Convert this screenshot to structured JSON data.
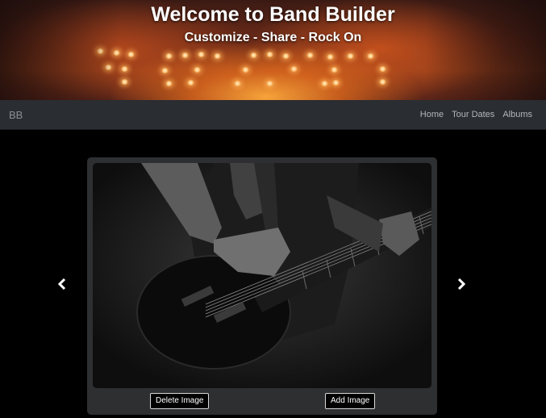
{
  "hero": {
    "title": "Welcome to Band Builder",
    "subtitle": "Customize - Share - Rock On"
  },
  "navbar": {
    "brand": "BB",
    "links": [
      "Home",
      "Tour Dates",
      "Albums"
    ]
  },
  "carousel": {
    "prev_icon": "chevron-left-icon",
    "next_icon": "chevron-right-icon",
    "image_alt": "Black and white photo of a guitarist playing an electric guitar",
    "delete_label": "Delete Image",
    "add_label": "Add Image"
  },
  "colors": {
    "page_background": "#000000",
    "navbar_background": "#2a2d31",
    "card_background": "#2e2f31",
    "hero_glow": "#e8822a"
  }
}
